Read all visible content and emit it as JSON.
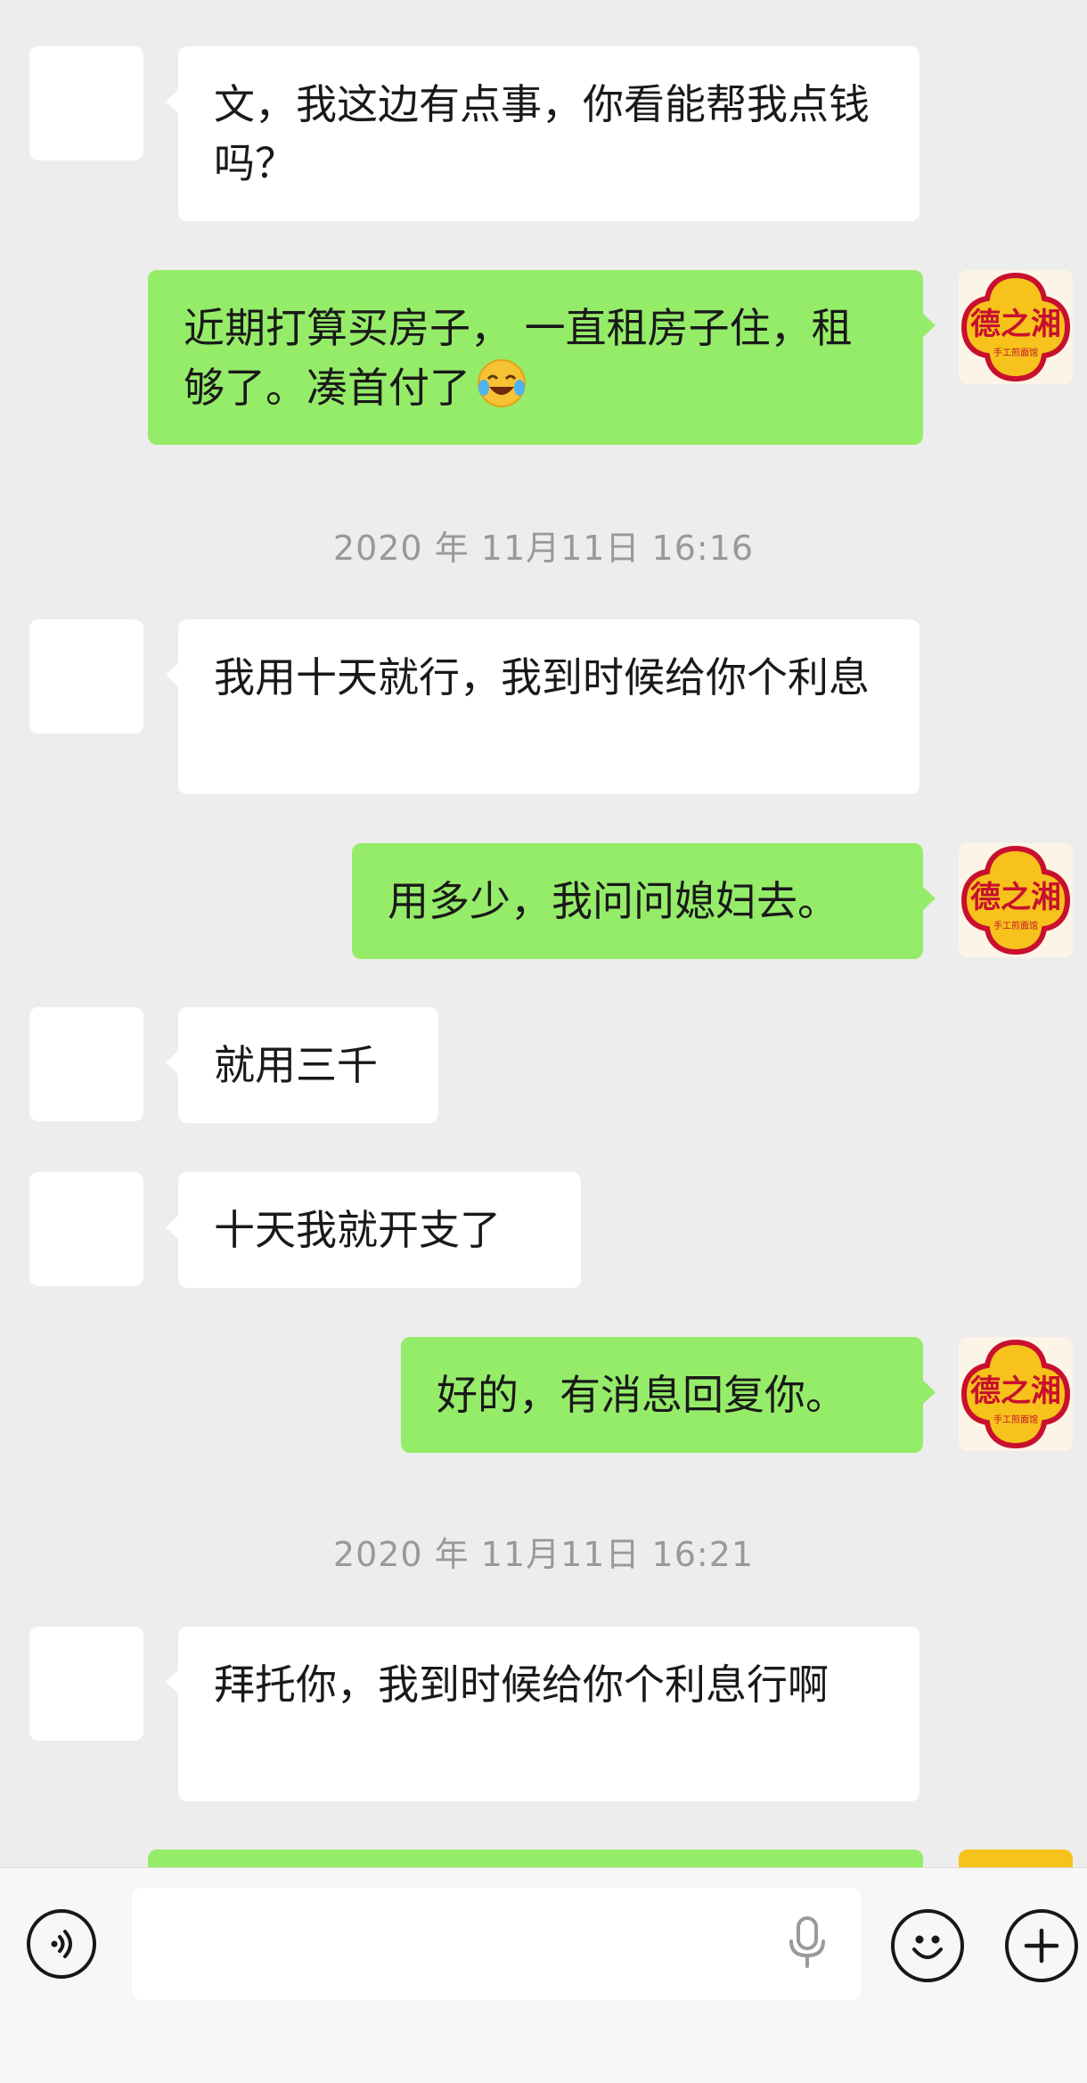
{
  "messages": [
    {
      "side": "in",
      "text": "文，我这边有点事，你看能帮我点钱吗？"
    },
    {
      "side": "out",
      "text": "近期打算买房子， 一直租房子住，租够了。凑首付了"
    },
    {
      "timestamp": "2020 年 11月11日 16:16"
    },
    {
      "side": "in",
      "text": "我用十天就行，我到时候给你个利息"
    },
    {
      "side": "out",
      "text": "用多少，我问问媳妇去。"
    },
    {
      "side": "in",
      "text": "就用三千"
    },
    {
      "side": "in",
      "text": "十天我就开支了"
    },
    {
      "side": "out",
      "text": "好的，有消息回复你。"
    },
    {
      "timestamp": "2020 年 11月11日 16:21"
    },
    {
      "side": "in",
      "text": "拜托你，我到时候给你个利息行啊"
    }
  ],
  "logo": {
    "main": "德之湘",
    "sub": "手工煎面馆"
  },
  "emoji": "laughing-crying-emoji",
  "colors": {
    "background": "#ededed",
    "outgoing": "#95ec69",
    "incoming": "#ffffff",
    "logo_red": "#c8102e",
    "logo_yellow": "#f6c21b"
  }
}
